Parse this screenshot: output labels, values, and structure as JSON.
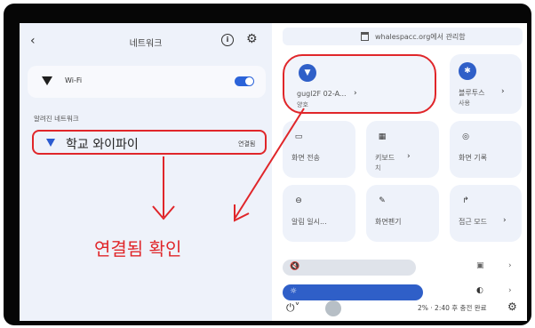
{
  "network_panel": {
    "back_icon": "back-arrow-icon",
    "title": "네트워크",
    "info_icon": "info-icon",
    "settings_icon": "gear-icon",
    "wifi_label": "Wi-Fi",
    "wifi_enabled": true,
    "known_networks_label": "알려진 네트워크",
    "network_name": "학교 와이파이",
    "network_status": "연결됨"
  },
  "annotation": {
    "confirm_text": "연결됨 확인",
    "accent_color": "#e0262a"
  },
  "quick_settings": {
    "managed_text": "whalespacc.org에서 관리함",
    "tiles": [
      {
        "label": "gugl2F 02-A...",
        "sub": "양호",
        "icon": "wifi-icon"
      },
      {
        "label": "블루투스",
        "sub": "사용",
        "icon": "bluetooth-icon"
      },
      {
        "label": "화면 전송",
        "sub": "",
        "icon": "cast-icon"
      },
      {
        "label": "키보드",
        "sub": "치",
        "icon": "keyboard-icon"
      },
      {
        "label": "화면 기록",
        "sub": "",
        "icon": "screen-record-icon"
      },
      {
        "label": "알림 일시...",
        "sub": "",
        "icon": "dnd-icon"
      },
      {
        "label": "화면펜기",
        "sub": "",
        "icon": "pen-icon"
      },
      {
        "label": "접근 모드",
        "sub": "",
        "icon": "accessibility-icon"
      }
    ],
    "volume_icon": "volume-muted-icon",
    "brightness_icon": "brightness-icon",
    "status_text": "2% · 2:40 후 충전 완료"
  },
  "colors": {
    "brand_blue": "#2f5fc8",
    "panel_bg": "#eef2fa"
  }
}
